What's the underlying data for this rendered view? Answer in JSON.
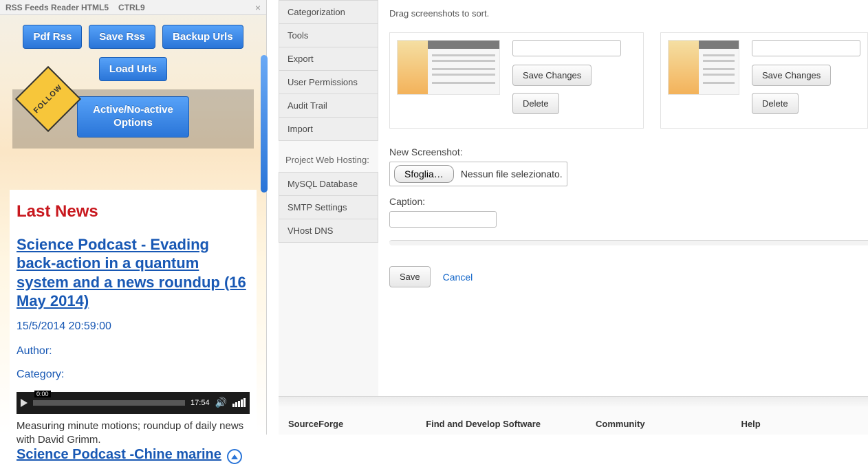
{
  "panel": {
    "title": "RSS Feeds Reader HTML5",
    "shortcut": "CTRL9",
    "buttons": {
      "pdf": "Pdf Rss",
      "save": "Save Rss",
      "backup": "Backup Urls",
      "load": "Load Urls",
      "options": "Active/No-active\nOptions"
    },
    "ribbon": "FOLLOW"
  },
  "news": {
    "heading": "Last News",
    "title": "Science Podcast - Evading back-action in a quantum system and a news roundup (16 May 2014)",
    "date": "15/5/2014 20:59:00",
    "author_label": "Author:",
    "category_label": "Category:",
    "audio": {
      "position": "0:00",
      "duration": "17:54"
    },
    "summary": "Measuring minute motions; roundup of daily news with David Grimm.",
    "next_title": "Science Podcast -Chine marine"
  },
  "sidebar": {
    "items": [
      "Categorization",
      "Tools",
      "Export",
      "User Permissions",
      "Audit Trail",
      "Import"
    ],
    "hosting_label": "Project Web Hosting:",
    "hosting_items": [
      "MySQL Database",
      "SMTP Settings",
      "VHost DNS"
    ]
  },
  "main": {
    "hint": "Drag screenshots to sort.",
    "save_changes": "Save Changes",
    "delete": "Delete",
    "new_screenshot_label": "New Screenshot:",
    "browse": "Sfoglia…",
    "no_file": "Nessun file selezionato.",
    "caption_label": "Caption:",
    "save": "Save",
    "cancel": "Cancel"
  },
  "footer": {
    "cols": [
      "SourceForge",
      "Find and Develop Software",
      "Community",
      "Help"
    ]
  }
}
